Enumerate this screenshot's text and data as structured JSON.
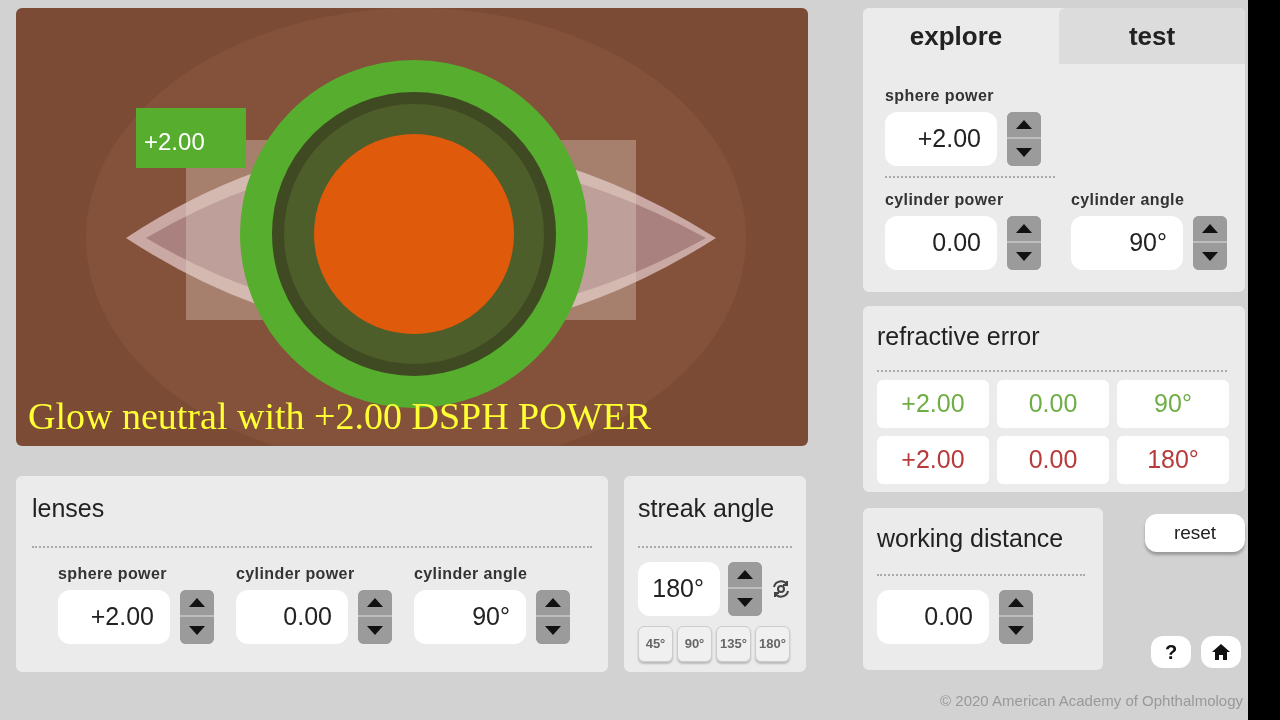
{
  "viewer": {
    "lens_label": "+2.00",
    "caption": "Glow neutral with +2.00 DSPH POWER"
  },
  "lenses": {
    "title": "lenses",
    "fields": [
      {
        "label": "sphere power",
        "value": "+2.00"
      },
      {
        "label": "cylinder power",
        "value": "0.00"
      },
      {
        "label": "cylinder angle",
        "value": "90°"
      }
    ]
  },
  "streak_angle": {
    "title": "streak angle",
    "value": "180°",
    "presets": [
      "45°",
      "90°",
      "135°",
      "180°"
    ]
  },
  "tabs": [
    {
      "label": "explore",
      "selected": true
    },
    {
      "label": "test",
      "selected": false
    }
  ],
  "explore_fields": [
    {
      "label": "sphere power",
      "value": "+2.00"
    },
    {
      "label": "cylinder power",
      "value": "0.00"
    },
    {
      "label": "cylinder angle",
      "value": "90°"
    }
  ],
  "refractive_error": {
    "title": "refractive error",
    "rows": [
      {
        "color": "#6fae45",
        "values": [
          "+2.00",
          "0.00",
          "90°"
        ]
      },
      {
        "color": "#b83a3a",
        "values": [
          "+2.00",
          "0.00",
          "180°"
        ]
      }
    ]
  },
  "working_distance": {
    "title": "working distance",
    "value": "0.00"
  },
  "reset_button": "reset",
  "help_button": "?",
  "footer": "© 2020 American Academy of Ophthalmology"
}
